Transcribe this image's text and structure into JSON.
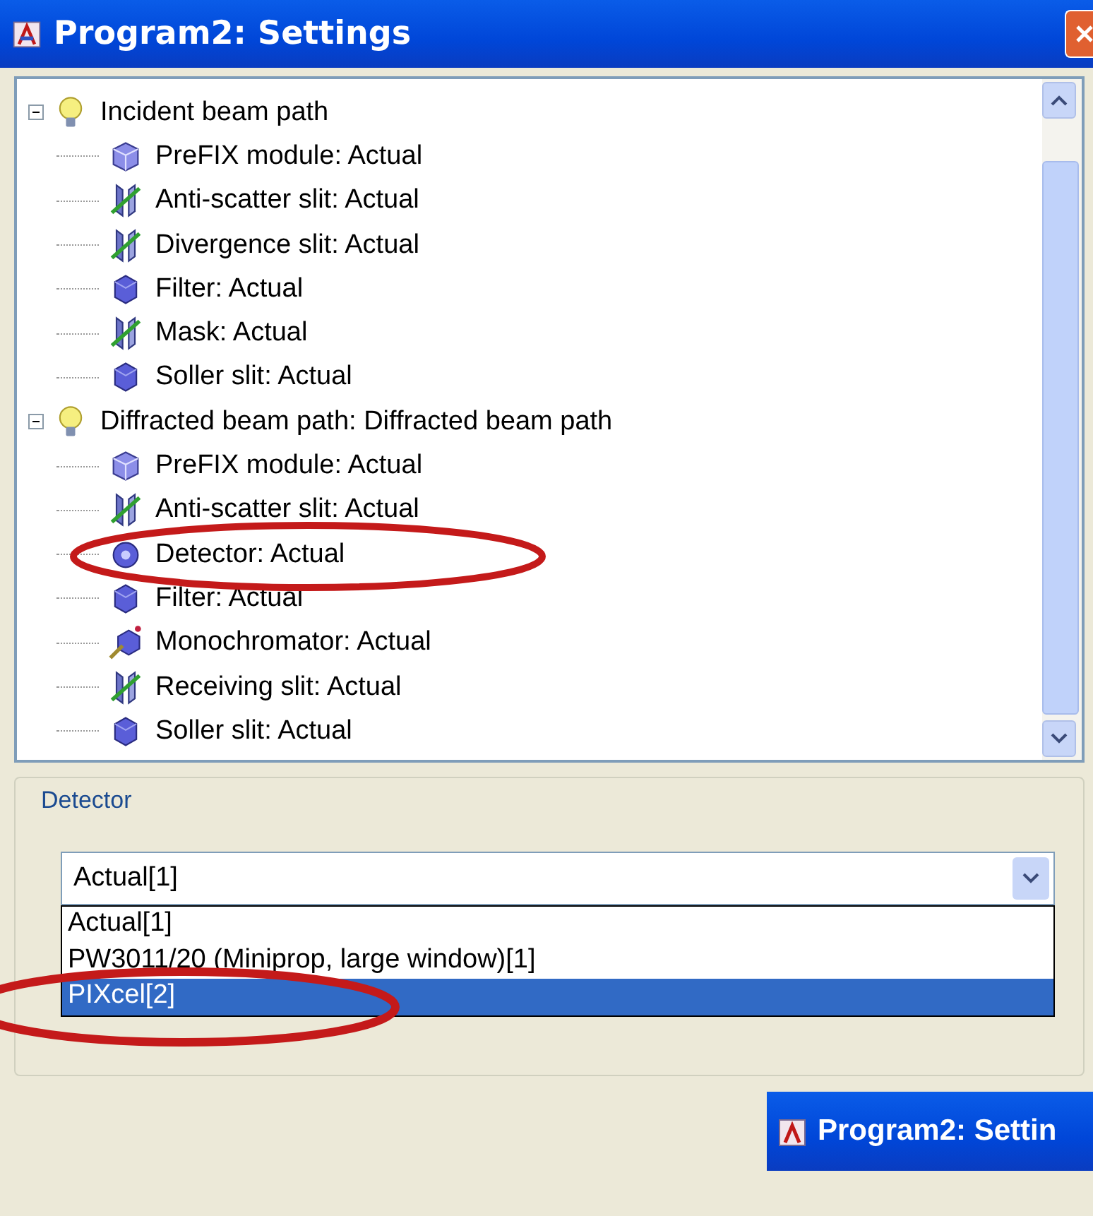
{
  "window": {
    "title": "Program2: Settings"
  },
  "tree": [
    {
      "label": "Incident beam path",
      "expanded": true,
      "children": [
        {
          "label": "PreFIX module: Actual",
          "kind": "module"
        },
        {
          "label": "Anti-scatter slit: Actual",
          "kind": "slit"
        },
        {
          "label": "Divergence slit: Actual",
          "kind": "slit"
        },
        {
          "label": "Filter: Actual",
          "kind": "cube"
        },
        {
          "label": "Mask: Actual",
          "kind": "slit"
        },
        {
          "label": "Soller slit: Actual",
          "kind": "cube"
        }
      ]
    },
    {
      "label": "Diffracted beam path: Diffracted beam path",
      "expanded": true,
      "children": [
        {
          "label": "PreFIX module: Actual",
          "kind": "module"
        },
        {
          "label": "Anti-scatter slit: Actual",
          "kind": "slit"
        },
        {
          "label": "Detector: Actual",
          "kind": "detector"
        },
        {
          "label": "Filter: Actual",
          "kind": "cube"
        },
        {
          "label": "Monochromator: Actual",
          "kind": "mono"
        },
        {
          "label": "Receiving slit: Actual",
          "kind": "slit"
        },
        {
          "label": "Soller slit: Actual",
          "kind": "cube"
        }
      ]
    }
  ],
  "detector_group": {
    "label": "Detector",
    "value": "Actual[1]",
    "options": [
      {
        "label": "Actual[1]",
        "highlighted": false
      },
      {
        "label": "PW3011/20 (Miniprop, large window)[1]",
        "highlighted": false
      },
      {
        "label": "PIXcel[2]",
        "highlighted": true
      }
    ]
  },
  "second_window": {
    "title": "Program2: Settin"
  }
}
